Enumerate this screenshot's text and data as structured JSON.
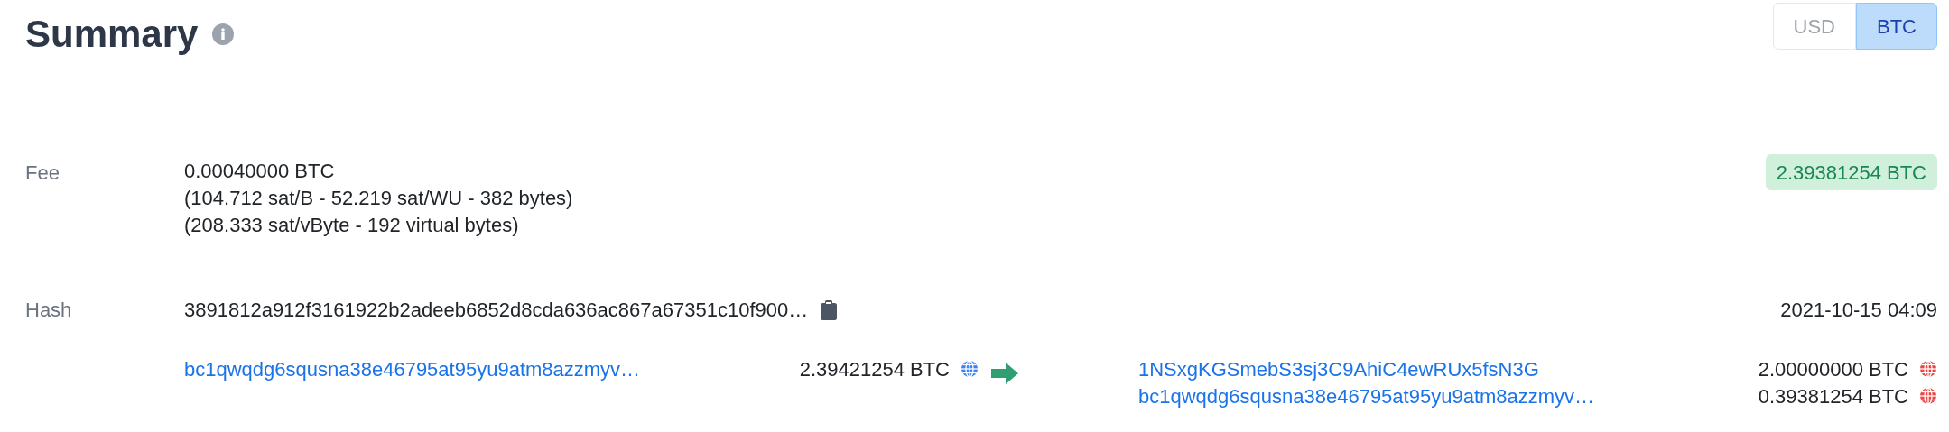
{
  "title": "Summary",
  "currency_toggle": [
    {
      "label": "USD",
      "selected": false
    },
    {
      "label": "BTC",
      "selected": true
    }
  ],
  "fee": {
    "label": "Fee",
    "lines": [
      "0.00040000 BTC",
      "(104.712 sat/B - 52.219 sat/WU - 382 bytes)",
      "(208.333 sat/vByte - 192 virtual bytes)"
    ],
    "total_badge": "2.39381254 BTC"
  },
  "hash": {
    "label": "Hash",
    "value": "3891812a912f3161922b2adeeb6852d8cda636ac867a67351c10f900…",
    "time": "2021-10-15 04:09"
  },
  "inputs": [
    {
      "address": "bc1qwqdg6squsna38e46795at95yu9atm8azzmyv…",
      "amount": "2.39421254 BTC",
      "color": "#3b82f6"
    }
  ],
  "outputs": [
    {
      "address": "1NSxgKGSmebS3sj3C9AhiC4ewRUx5fsN3G",
      "amount": "2.00000000 BTC",
      "color": "#ef4444"
    },
    {
      "address": "bc1qwqdg6squsna38e46795at95yu9atm8azzmyv…",
      "amount": "0.39381254 BTC",
      "color": "#ef4444"
    }
  ]
}
